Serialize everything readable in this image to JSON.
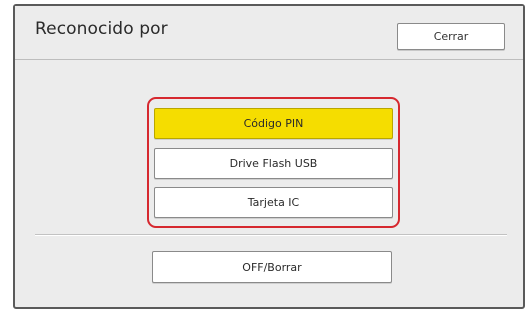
{
  "dialog": {
    "title": "Reconocido por",
    "close_label": "Cerrar"
  },
  "options": [
    {
      "label": "Código PIN",
      "selected": true
    },
    {
      "label": "Drive Flash USB",
      "selected": false
    },
    {
      "label": "Tarjeta IC",
      "selected": false
    }
  ],
  "off_label": "OFF/Borrar",
  "colors": {
    "selected_fill": "#f5dd00",
    "highlight_border": "#d6282f",
    "panel_background": "#ececec"
  }
}
